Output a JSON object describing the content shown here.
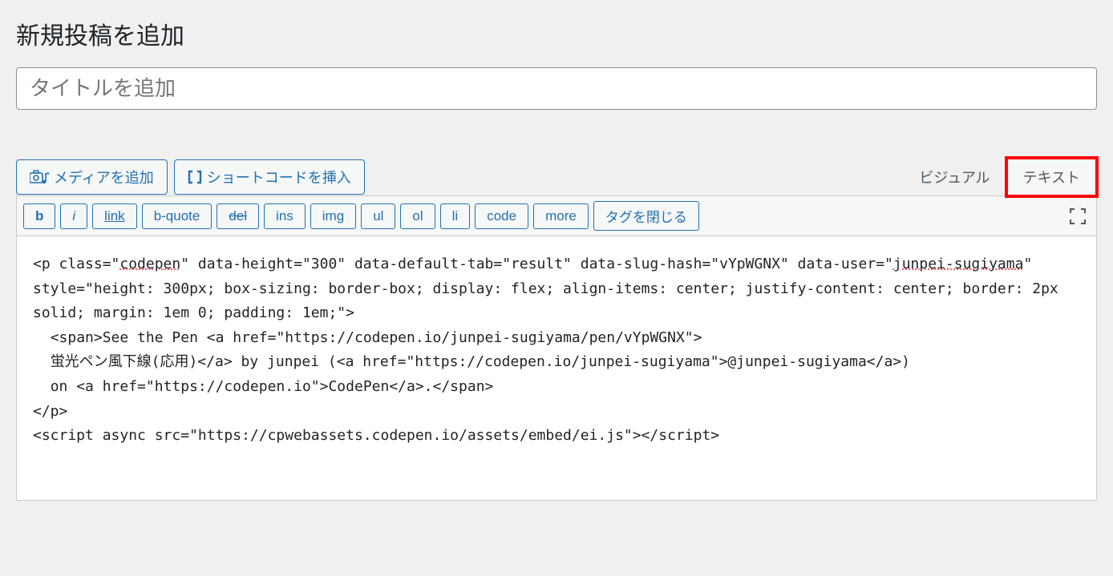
{
  "page_title": "新規投稿を追加",
  "title_placeholder": "タイトルを追加",
  "buttons": {
    "add_media": "メディアを追加",
    "insert_shortcode": "ショートコードを挿入"
  },
  "tabs": {
    "visual": "ビジュアル",
    "text": "テキスト"
  },
  "toolbar": {
    "b": "b",
    "i": "i",
    "link": "link",
    "bquote": "b-quote",
    "del": "del",
    "ins": "ins",
    "img": "img",
    "ul": "ul",
    "ol": "ol",
    "li": "li",
    "code": "code",
    "more": "more",
    "close_tags": "タグを閉じる"
  },
  "editor_content": "<p class=\"codepen\" data-height=\"300\" data-default-tab=\"result\" data-slug-hash=\"vYpWGNX\" data-user=\"junpei-sugiyama\" style=\"height: 300px; box-sizing: border-box; display: flex; align-items: center; justify-content: center; border: 2px solid; margin: 1em 0; padding: 1em;\">\n  <span>See the Pen <a href=\"https://codepen.io/junpei-sugiyama/pen/vYpWGNX\">\n  蛍光ペン風下線(応用)</a> by junpei (<a href=\"https://codepen.io/junpei-sugiyama\">@junpei-sugiyama</a>)\n  on <a href=\"https://codepen.io\">CodePen</a>.</span>\n</p>\n<script async src=\"https://cpwebassets.codepen.io/assets/embed/ei.js\"></script>"
}
